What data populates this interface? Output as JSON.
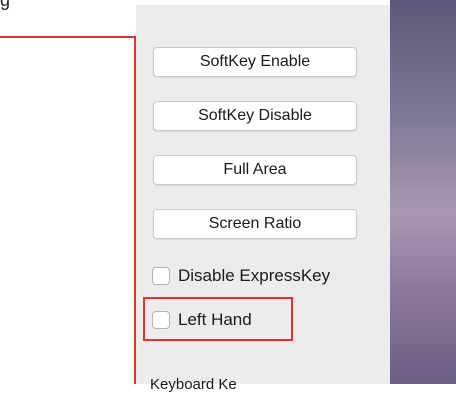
{
  "window": {
    "title_fragment": "g"
  },
  "buttons": {
    "softkey_enable": "SoftKey Enable",
    "softkey_disable": "SoftKey Disable",
    "full_area": "Full Area",
    "screen_ratio": "Screen Ratio"
  },
  "checkboxes": {
    "disable_expresskey": {
      "label": "Disable ExpressKey",
      "checked": false
    },
    "left_hand": {
      "label": "Left Hand",
      "checked": false
    }
  },
  "section": {
    "partial_label": "Keyboard Ke"
  },
  "colors": {
    "panel_bg": "#ececec",
    "highlight": "#e5332a",
    "button_bg": "#ffffff"
  }
}
